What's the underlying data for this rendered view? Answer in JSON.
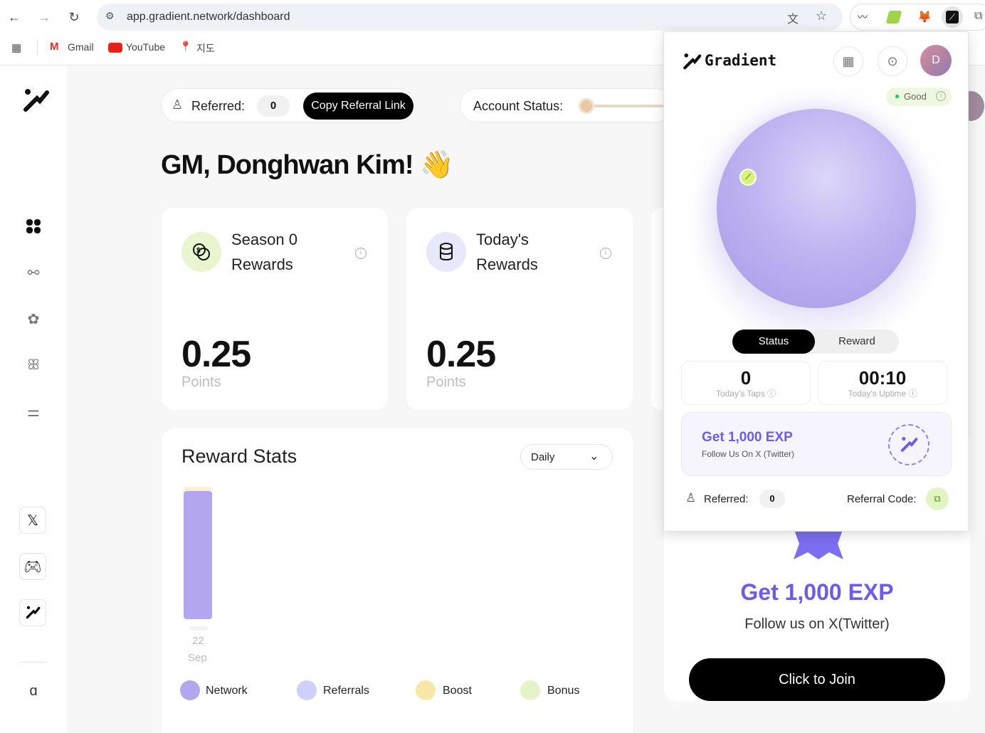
{
  "browser": {
    "url": "app.gradient.network/dashboard",
    "bookmarks": [
      "Gmail",
      "YouTube",
      "지도"
    ]
  },
  "header": {
    "referred_label": "Referred:",
    "referred_count": "0",
    "copy_referral": "Copy Referral Link",
    "account_status_label": "Account Status:"
  },
  "greeting": "GM, Donghwan Kim!",
  "greeting_emoji": "👋",
  "cards": [
    {
      "title_line1": "Season 0",
      "title_line2": "Rewards",
      "value": "0.25",
      "unit": "Points",
      "icon": "coins-icon"
    },
    {
      "title_line1": "Today's",
      "title_line2": "Rewards",
      "value": "0.25",
      "unit": "Points",
      "icon": "database-icon"
    }
  ],
  "reward_stats": {
    "title": "Reward Stats",
    "period": "Daily",
    "x_day": "22",
    "x_month": "Sep",
    "legend": [
      {
        "label": "Network",
        "color": "#b3a6ee"
      },
      {
        "label": "Referrals",
        "color": "#cdd1fa"
      },
      {
        "label": "Boost",
        "color": "#f7e7a8"
      },
      {
        "label": "Bonus",
        "color": "#e5f3c9"
      }
    ]
  },
  "promo": {
    "title": "Get 1,000 EXP",
    "subtitle": "Follow us on X(Twitter)",
    "button": "Click to Join"
  },
  "popup": {
    "brand": "Gradient",
    "avatar": "D",
    "status": "Good",
    "tab_status": "Status",
    "tab_reward": "Reward",
    "taps_value": "0",
    "taps_label": "Today's Taps",
    "uptime_value": "00:10",
    "uptime_label": "Today's Uptime",
    "exp_title": "Get 1,000 EXP",
    "exp_sub": "Follow Us On X (Twitter)",
    "referred_label": "Referred:",
    "referred_count": "0",
    "referral_code_label": "Referral Code:"
  },
  "colors": {
    "accent_purple": "#6e5ce6",
    "bar_purple": "#b3a6ee",
    "good_green": "#22c55e"
  }
}
